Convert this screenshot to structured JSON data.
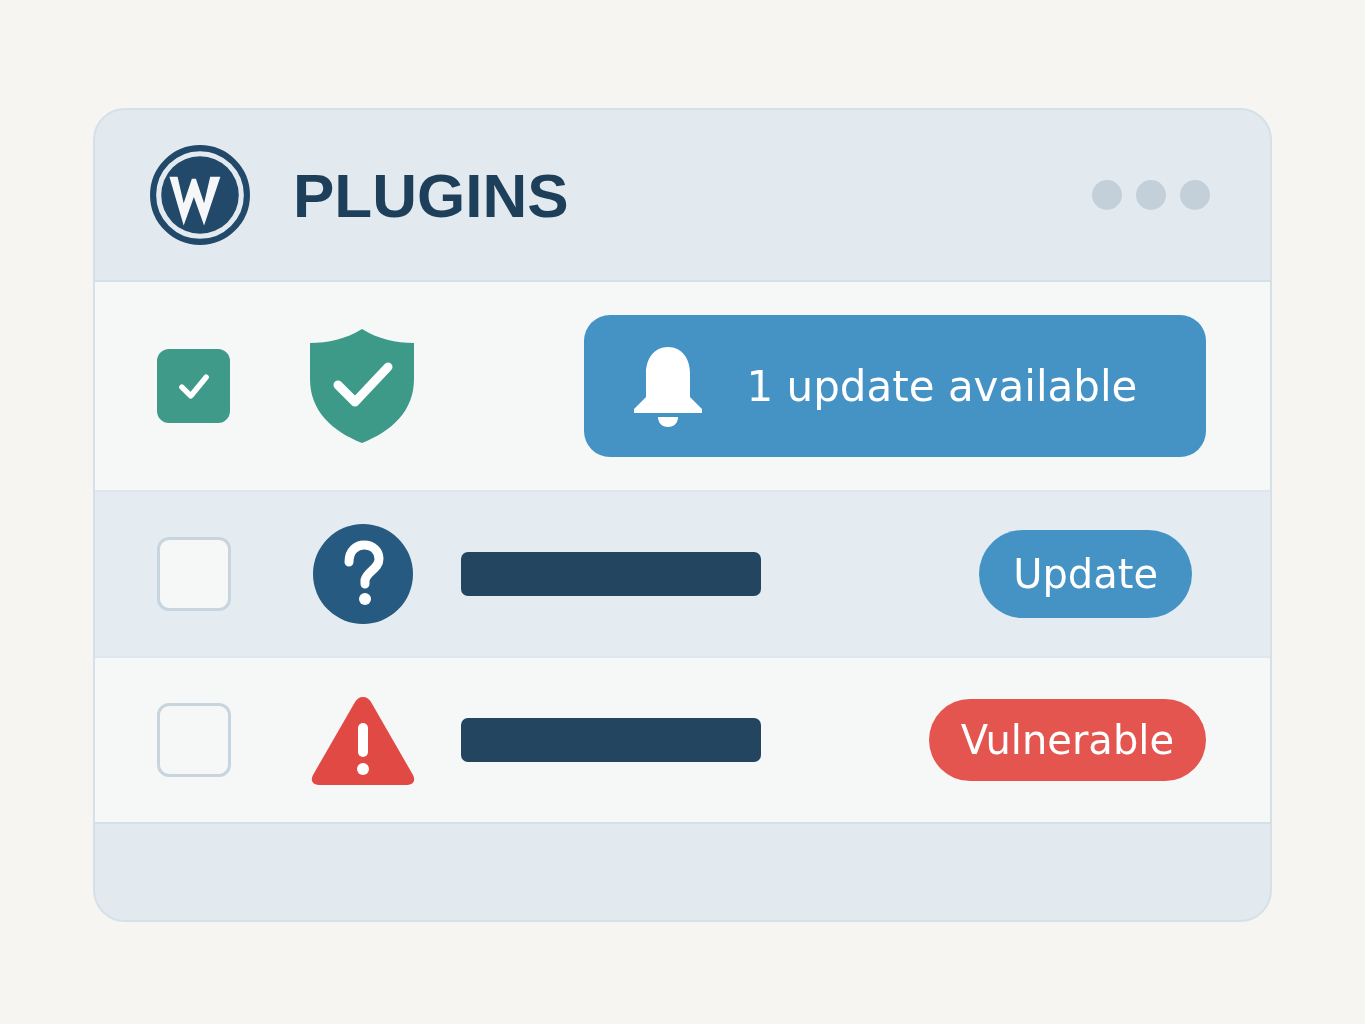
{
  "window": {
    "title": "PLUGINS"
  },
  "rows": [
    {
      "kind": "notice",
      "checked": true,
      "status": {
        "kind": "verified"
      },
      "notice": "1 update available"
    },
    {
      "kind": "plugin",
      "checked": false,
      "status": {
        "kind": "unknown"
      },
      "action": {
        "kind": "button",
        "label": "Update"
      }
    },
    {
      "kind": "plugin",
      "checked": false,
      "status": {
        "kind": "warning"
      },
      "action": {
        "kind": "badge",
        "label": "Vulnerable"
      }
    }
  ]
}
